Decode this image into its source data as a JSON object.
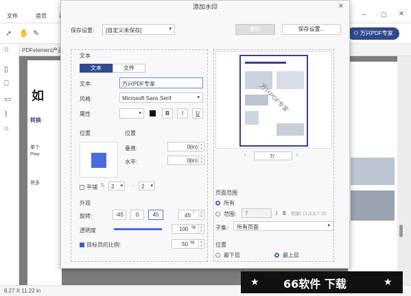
{
  "app": {
    "menu": [
      "文件",
      "首页",
      "视"
    ],
    "doc_tab": "PDFelement产品...",
    "page_size_status": "8.27 X 11.22 in",
    "expert_button": "万兴PDF专家",
    "doc_heading_char": "如",
    "doc_lines": [
      "转换",
      "单个",
      "Pow",
      "将多"
    ]
  },
  "dialog": {
    "title": "添加水印",
    "save_settings_label": "保存设置:",
    "save_settings_value": "[自定义未保存]",
    "delete_button": "删除",
    "save_settings_button": "保存设置...",
    "section_text": "文本",
    "tab_text": "文本",
    "tab_file": "文件",
    "text_label": "文本:",
    "text_value": "万兴PDF专家",
    "style_label": "风格:",
    "style_value": "Microsoft Sans Serif",
    "attr_label": "属性",
    "bold_label": "B",
    "italic_label": "I",
    "underline_label": "U",
    "position_header_1": "位置",
    "position_header_2": "位置",
    "vertical_label": "垂直:",
    "vertical_value": "0",
    "vertical_unit": "(in)",
    "horizontal_label": "水平:",
    "horizontal_value": "0",
    "horizontal_unit": "(in)",
    "tile_label": "平铺",
    "tile_rows": "2",
    "tile_cols": "2",
    "appearance_label": "外观",
    "rotate_label": "旋转:",
    "rotate_options": [
      "-45",
      "0",
      "45"
    ],
    "rotate_value": "45",
    "rotate_unit": "°",
    "opacity_label": "透明度",
    "opacity_value": "100",
    "opacity_unit": "%",
    "opacity_level": 1.0,
    "scale_label": "目标页的比例:",
    "scale_value": "50",
    "scale_unit": "%",
    "preview_page_value": "7/",
    "preview_watermark_text": "万兴PDF专家",
    "page_range_label": "页面范围",
    "all_label": "所有",
    "range_label": "范围:",
    "range_from": "7",
    "range_sep": "/",
    "range_total": "8",
    "range_example": "例如: (1,3,5,7-10",
    "subset_label": "子集:",
    "subset_value": "所有页面",
    "layer_label": "位置",
    "layer_bottom": "最下层",
    "layer_top": "最上层"
  },
  "banner": {
    "text": "66软件 下载",
    "star_left": "★",
    "star_right": "★"
  },
  "colors": {
    "accent": "#3f5fc4",
    "expert_button_bg": "#2f4a8f",
    "tab_active_bg": "#2f4a8f"
  }
}
